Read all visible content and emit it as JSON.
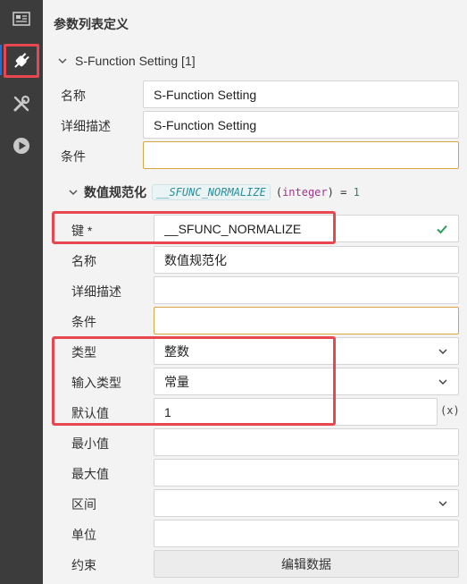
{
  "activity_bar": {
    "items": [
      {
        "icon": "preview-icon"
      },
      {
        "icon": "plugin-icon"
      },
      {
        "icon": "tools-icon"
      },
      {
        "icon": "run-icon"
      }
    ]
  },
  "panel": {
    "title": "参数列表定义"
  },
  "group": {
    "title": "S-Function Setting [1]",
    "fields": {
      "name_label": "名称",
      "name_value": "S-Function Setting",
      "desc_label": "详细描述",
      "desc_value": "S-Function Setting",
      "cond_label": "条件",
      "cond_value": ""
    }
  },
  "param": {
    "title": "数值规范化",
    "key_tag": "__SFUNC_NORMALIZE",
    "type_open": "(",
    "type_kw": "integer",
    "type_close": ")",
    "eq": " = ",
    "default_num": "1",
    "fields": {
      "key_label": "键 *",
      "key_value": "__SFUNC_NORMALIZE",
      "name_label": "名称",
      "name_value": "数值规范化",
      "desc_label": "详细描述",
      "desc_value": "",
      "cond_label": "条件",
      "cond_value": "",
      "type_label": "类型",
      "type_value": "整数",
      "input_type_label": "输入类型",
      "input_type_value": "常量",
      "default_label": "默认值",
      "default_value": "1",
      "expr_toggle": "(x)",
      "min_label": "最小值",
      "min_value": "",
      "max_label": "最大值",
      "max_value": "",
      "range_label": "区间",
      "range_value": "",
      "unit_label": "单位",
      "unit_value": "",
      "constraint_label": "约束",
      "edit_button": "编辑数据"
    }
  },
  "colors": {
    "highlight": "#e8474f",
    "warn_border": "#d9a441",
    "valid_check": "#2e9e5b",
    "activity_bg": "#3c3c3c"
  }
}
